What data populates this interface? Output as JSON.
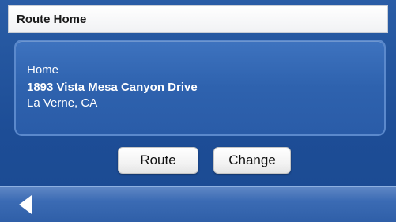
{
  "header": {
    "title": "Route Home"
  },
  "destination": {
    "name": "Home",
    "street": "1893 Vista Mesa Canyon Drive",
    "city_state": "La Verne, CA"
  },
  "actions": {
    "route_label": "Route",
    "change_label": "Change"
  },
  "footer": {
    "back_icon": "left-arrow-icon"
  }
}
